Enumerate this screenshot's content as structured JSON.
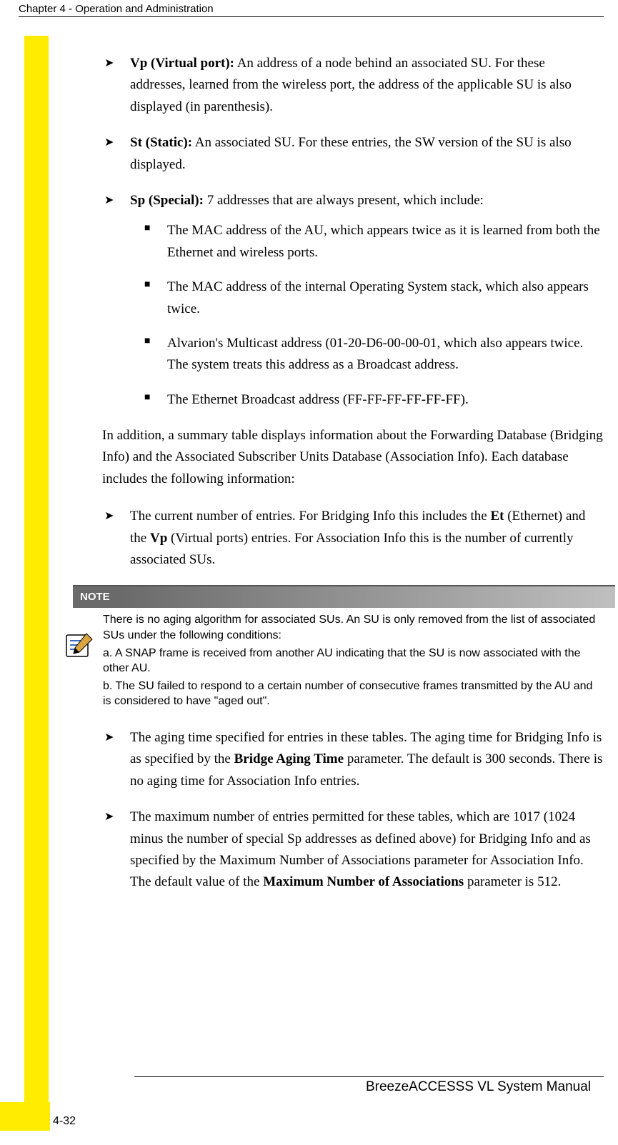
{
  "header": {
    "left": "Chapter 4 - Operation and Administration",
    "right": ""
  },
  "bullets1": {
    "b0_bold": "Vp (Virtual port):",
    "b0_text": " An address of a node behind an associated SU. For these addresses, learned from the wireless port, the address of the applicable SU is also displayed (in parenthesis).",
    "b1_bold": "St (Static):",
    "b1_text": " An associated SU. For these entries, the SW version of the SU is also displayed.",
    "b2_bold": "Sp (Special):",
    "b2_text": " 7 addresses that are always present, which include:"
  },
  "nested": {
    "n0": "The MAC address of the AU, which appears twice as it is learned from both the Ethernet and wireless ports.",
    "n1": "The MAC address of the internal Operating System stack, which also appears twice.",
    "n2": "Alvarion's Multicast address (01-20-D6-00-00-01, which also appears twice. The system treats this address as a Broadcast address.",
    "n3": "The Ethernet Broadcast address (FF-FF-FF-FF-FF-FF)."
  },
  "para1": "In addition, a summary table displays information about the Forwarding Database (Bridging Info) and the Associated Subscriber Units Database (Association Info). Each database includes the following information:",
  "bullets2": {
    "b0_a": "The current number of entries. For Bridging Info this includes the ",
    "b0_bold1": "Et",
    "b0_b": " (Ethernet) and the ",
    "b0_bold2": "Vp",
    "b0_c": " (Virtual ports) entries. For Association Info this is the number of currently associated SUs."
  },
  "note": {
    "label": "NOTE",
    "p0": "There is no aging algorithm for associated SUs. An SU is only removed from the list of associated SUs under the following conditions:",
    "p1": "a. A SNAP frame is received from another AU indicating that the SU is now associated with the other AU.",
    "p2": "b. The SU failed to respond to a certain number of consecutive frames transmitted by the AU and is considered to have \"aged out\"."
  },
  "bullets3": {
    "b0_a": "The aging time specified for entries in these tables. The aging time for Bridging Info is as specified by the ",
    "b0_bold": "Bridge Aging Time",
    "b0_b": " parameter. The default is 300 seconds. There is no aging time for Association Info entries.",
    "b1_a": "The maximum number of entries permitted for these tables, which are 1017 (1024 minus the number of special Sp addresses as defined above) for Bridging Info and as specified by the Maximum Number of Associations parameter for Association Info. The default value of the ",
    "b1_bold": "Maximum Number of Associations",
    "b1_b": " parameter is 512."
  },
  "footer": {
    "manual": "BreezeACCESSS VL System Manual",
    "page": "4-32"
  }
}
